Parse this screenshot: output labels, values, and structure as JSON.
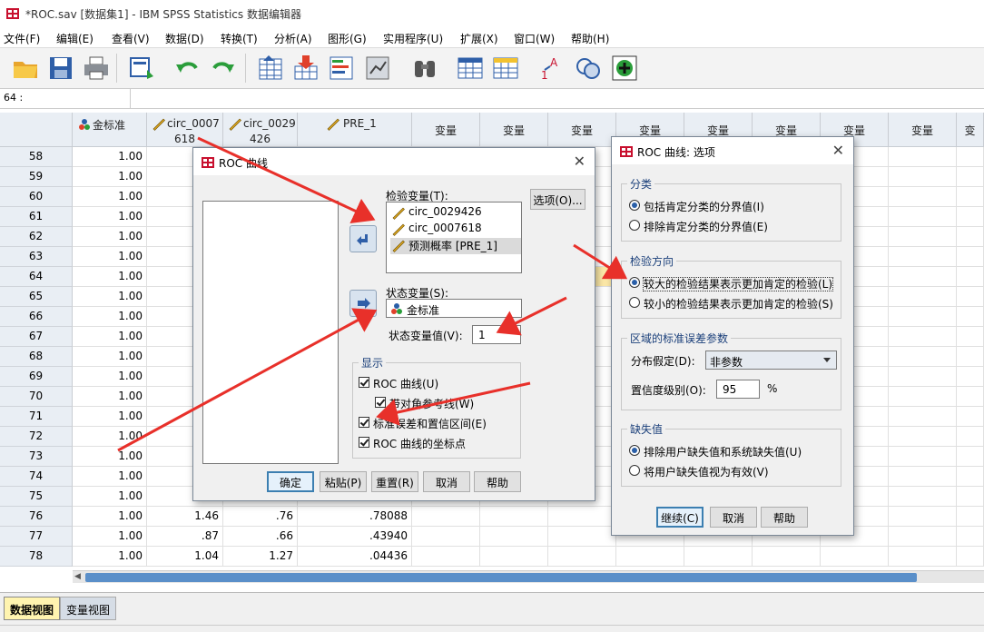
{
  "window": {
    "title": "*ROC.sav [数据集1] - IBM SPSS Statistics 数据编辑器"
  },
  "menu": [
    "文件(F)",
    "编辑(E)",
    "查看(V)",
    "数据(D)",
    "转换(T)",
    "分析(A)",
    "图形(G)",
    "实用程序(U)",
    "扩展(X)",
    "窗口(W)",
    "帮助(H)"
  ],
  "cell_ref": "64 :",
  "grid": {
    "columns": [
      {
        "line1": "金标准",
        "line2": ""
      },
      {
        "line1": "circ_0007",
        "line2": "618"
      },
      {
        "line1": "circ_0029",
        "line2": "426"
      },
      {
        "line1": "PRE_1",
        "line2": ""
      },
      {
        "line1": "变量"
      },
      {
        "line1": "变量"
      },
      {
        "line1": "变量"
      },
      {
        "line1": "变量"
      },
      {
        "line1": "变量"
      },
      {
        "line1": "变量"
      },
      {
        "line1": "变量"
      },
      {
        "line1": "变量"
      },
      {
        "line1": "变"
      }
    ],
    "rows": [
      {
        "n": "58",
        "v": [
          "1.00",
          "",
          "",
          ""
        ]
      },
      {
        "n": "59",
        "v": [
          "1.00",
          "",
          "",
          ""
        ]
      },
      {
        "n": "60",
        "v": [
          "1.00",
          "",
          "",
          ""
        ]
      },
      {
        "n": "61",
        "v": [
          "1.00",
          "",
          "",
          ""
        ]
      },
      {
        "n": "62",
        "v": [
          "1.00",
          "",
          "",
          ""
        ]
      },
      {
        "n": "63",
        "v": [
          "1.00",
          "",
          "",
          ""
        ]
      },
      {
        "n": "64",
        "v": [
          "1.00",
          "",
          "",
          ""
        ]
      },
      {
        "n": "65",
        "v": [
          "1.00",
          "",
          "",
          ""
        ]
      },
      {
        "n": "66",
        "v": [
          "1.00",
          "",
          "",
          ""
        ]
      },
      {
        "n": "67",
        "v": [
          "1.00",
          "",
          "",
          ""
        ]
      },
      {
        "n": "68",
        "v": [
          "1.00",
          "",
          "",
          ""
        ]
      },
      {
        "n": "69",
        "v": [
          "1.00",
          "",
          "",
          ""
        ]
      },
      {
        "n": "70",
        "v": [
          "1.00",
          "",
          "",
          ""
        ]
      },
      {
        "n": "71",
        "v": [
          "1.00",
          "",
          "",
          ""
        ]
      },
      {
        "n": "72",
        "v": [
          "1.00",
          "",
          "",
          ""
        ]
      },
      {
        "n": "73",
        "v": [
          "1.00",
          "",
          "",
          ""
        ]
      },
      {
        "n": "74",
        "v": [
          "1.00",
          "",
          "",
          ""
        ]
      },
      {
        "n": "75",
        "v": [
          "1.00",
          "",
          "",
          ""
        ]
      },
      {
        "n": "76",
        "v": [
          "1.00",
          "1.46",
          ".76",
          ".78088"
        ]
      },
      {
        "n": "77",
        "v": [
          "1.00",
          ".87",
          ".66",
          ".43940"
        ]
      },
      {
        "n": "78",
        "v": [
          "1.00",
          "1.04",
          "1.27",
          ".04436"
        ]
      }
    ]
  },
  "view_tabs": [
    "数据视图",
    "变量视图"
  ],
  "roc_dialog": {
    "title": "ROC 曲线",
    "test_label": "检验变量(T):",
    "test_vars": [
      "circ_0029426",
      "circ_0007618",
      "预测概率 [PRE_1]"
    ],
    "state_label": "状态变量(S):",
    "state_var": "金标准",
    "state_value_label": "状态变量值(V):",
    "state_value": "1",
    "options_btn": "选项(O)...",
    "display_title": "显示",
    "display": [
      "ROC 曲线(U)",
      "带对角参考线(W)",
      "标准误差和置信区间(E)",
      "ROC 曲线的坐标点"
    ],
    "buttons": [
      "确定",
      "粘贴(P)",
      "重置(R)",
      "取消",
      "帮助"
    ]
  },
  "options_dialog": {
    "title": "ROC 曲线: 选项",
    "classification_title": "分类",
    "classification": [
      "包括肯定分类的分界值(I)",
      "排除肯定分类的分界值(E)"
    ],
    "direction_title": "检验方向",
    "direction": [
      "较大的检验结果表示更加肯定的检验(L)",
      "较小的检验结果表示更加肯定的检验(S)"
    ],
    "se_title": "区域的标准误差参数",
    "dist_label": "分布假定(D):",
    "dist_value": "非参数",
    "ci_label": "置信度级别(O):",
    "ci_value": "95",
    "ci_unit": "%",
    "missing_title": "缺失值",
    "missing": [
      "排除用户缺失值和系统缺失值(U)",
      "将用户缺失值视为有效(V)"
    ],
    "buttons": [
      "继续(C)",
      "取消",
      "帮助"
    ]
  },
  "colors": {
    "annotation_arrow": "#e8302a",
    "header_bg": "#e9eef4",
    "accent": "#3c7fb1"
  }
}
